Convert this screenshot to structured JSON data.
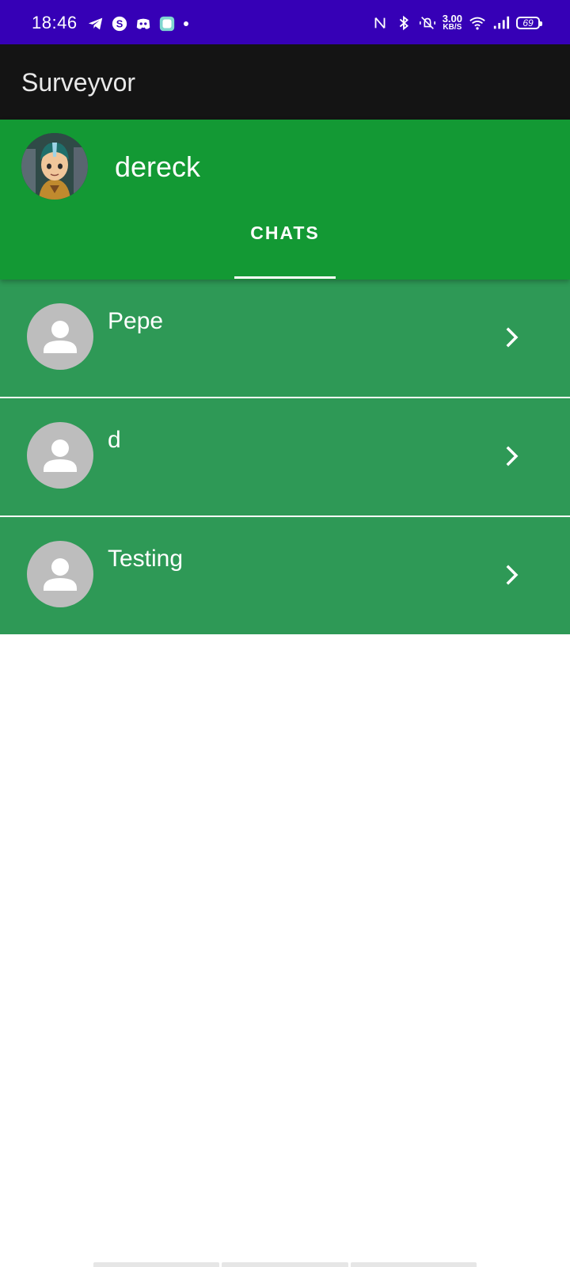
{
  "status_bar": {
    "time": "18:46",
    "net_speed_value": "3.00",
    "net_speed_unit": "KB/S",
    "battery": "69",
    "background_color": "#3600b6",
    "left_icons": [
      "telegram-icon",
      "skype-icon",
      "discord-icon",
      "app-notification-icon",
      "dot-icon"
    ],
    "right_icons": [
      "nfc-icon",
      "bluetooth-icon",
      "vibrate-icon",
      "wifi-icon",
      "signal-icon",
      "battery-icon"
    ]
  },
  "app_bar": {
    "title": "Surveyvor",
    "background_color": "#141414"
  },
  "profile": {
    "name": "dereck",
    "background_color": "#139934"
  },
  "tabs": [
    {
      "label": "CHATS",
      "selected": true
    }
  ],
  "chats": [
    {
      "name": "Pepe"
    },
    {
      "name": "d"
    },
    {
      "name": "Testing"
    }
  ],
  "colors": {
    "chat_row": "#2e9956",
    "avatar_placeholder": "#bdbdbd"
  }
}
